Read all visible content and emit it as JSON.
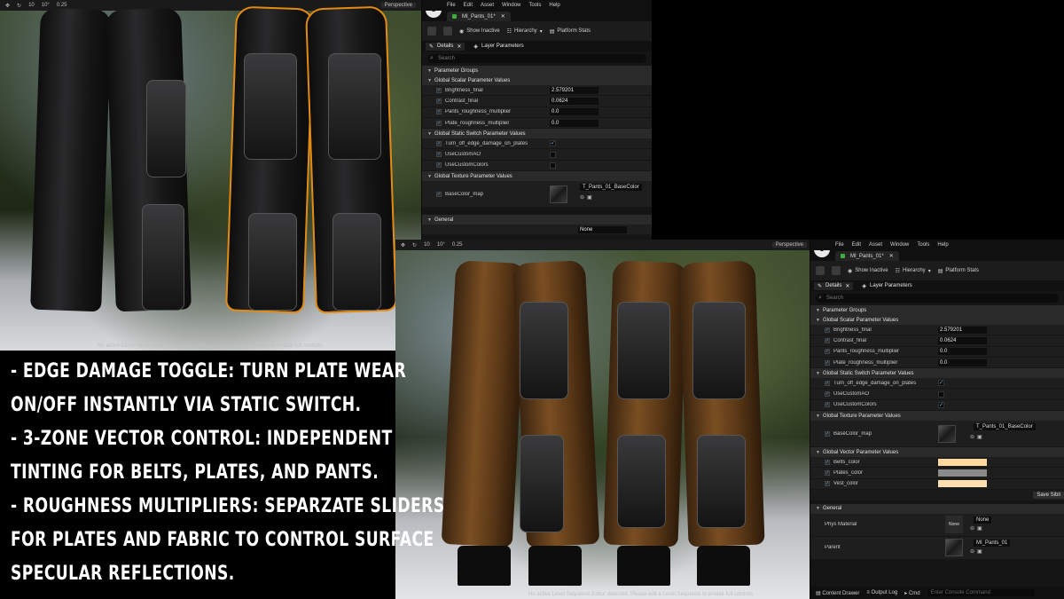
{
  "editor_a": {
    "menu": [
      "File",
      "Edit",
      "Asset",
      "Window",
      "Tools",
      "Help"
    ],
    "asset_tab": "MI_Pants_01*",
    "toolbar": {
      "show_inactive": "Show Inactive",
      "hierarchy": "Hierarchy",
      "platform_stats": "Platform Stats"
    },
    "panel_tabs": {
      "details": "Details",
      "layer_parameters": "Layer Parameters"
    },
    "search_placeholder": "Search",
    "parameter_groups": "Parameter Groups",
    "scalar_group": "Global Scalar Parameter Values",
    "scalars": [
      {
        "name": "Brightness_final",
        "value": "2.579201"
      },
      {
        "name": "Contrast_final",
        "value": "0.0624"
      },
      {
        "name": "Pants_roughness_multiplier",
        "value": "0.0"
      },
      {
        "name": "Plate_roughness_multiplier",
        "value": "0.0"
      }
    ],
    "switch_group": "Global Static Switch Parameter Values",
    "switches": [
      {
        "name": "Turn_off_edge_damage_on_plates",
        "checked": "✓"
      },
      {
        "name": "UseCustomAO",
        "checked": ""
      },
      {
        "name": "UseCustomColors",
        "checked": ""
      }
    ],
    "texture_group": "Global Texture Parameter Values",
    "texture": {
      "name": "BaseColor_map",
      "value": "T_Pants_01_BaseColor"
    },
    "general": "General",
    "none_value": "None"
  },
  "editor_b": {
    "menu": [
      "File",
      "Edit",
      "Asset",
      "Window",
      "Tools",
      "Help"
    ],
    "asset_tab": "MI_Pants_01*",
    "toolbar": {
      "show_inactive": "Show Inactive",
      "hierarchy": "Hierarchy",
      "platform_stats": "Platform Stats"
    },
    "panel_tabs": {
      "details": "Details",
      "layer_parameters": "Layer Parameters"
    },
    "search_placeholder": "Search",
    "parameter_groups": "Parameter Groups",
    "scalar_group": "Global Scalar Parameter Values",
    "scalars": [
      {
        "name": "Brightness_final",
        "value": "2.579201"
      },
      {
        "name": "Contrast_final",
        "value": "0.0624"
      },
      {
        "name": "Pants_roughness_multiplier",
        "value": "0.0"
      },
      {
        "name": "Plate_roughness_multiplier",
        "value": "0.0"
      }
    ],
    "switch_group": "Global Static Switch Parameter Values",
    "switches": [
      {
        "name": "Turn_off_edge_damage_on_plates",
        "checked": "✓"
      },
      {
        "name": "UseCustomAO",
        "checked": ""
      },
      {
        "name": "UseCustomColors",
        "checked": "✓"
      }
    ],
    "texture_group": "Global Texture Parameter Values",
    "texture": {
      "name": "BaseColor_map",
      "value": "T_Pants_01_BaseColor"
    },
    "vector_group": "Global Vector Parameter Values",
    "vectors": [
      {
        "name": "Belts_color",
        "color": "#ffd9a0"
      },
      {
        "name": "Plates_color",
        "color": "#8a8a8a"
      },
      {
        "name": "Vest_color",
        "color": "#ffe0ae"
      }
    ],
    "save_sibling": "Save Sibli",
    "general": "General",
    "phys_material": {
      "label": "Phys Material",
      "value": "None",
      "thumb": "None"
    },
    "parent": {
      "label": "Parent",
      "value": "MI_Pants_01"
    },
    "bottom": {
      "content_drawer": "Content Drawer",
      "output_log": "Output Log",
      "cmd": "Cmd",
      "console_placeholder": "Enter Console Command"
    }
  },
  "viewport_a": {
    "perspective": "Perspective",
    "grid": "10",
    "rot": "10°",
    "scale": "0.25",
    "status": "No active Level Sequence Editor detected. Please edit a Level Sequence to enable full controls."
  },
  "viewport_b": {
    "perspective": "Perspective",
    "grid": "10",
    "rot": "10°",
    "scale": "0.25",
    "status": "No active Level Sequence Editor detected. Please edit a Level Sequence to enable full controls."
  },
  "caption": {
    "line1": " - Edge damage toggle: Turn plate wear",
    "line2": "on/off instantly via static switch.",
    "line3": " - 3-Zone Vector Control: Independent",
    "line4": "tinting for belts, plates, and pants.",
    "line5": "- Roughness Multipliers: Separzate sliders",
    "line6": "for plates and fabric to control surface",
    "line7": " specular reflections."
  }
}
